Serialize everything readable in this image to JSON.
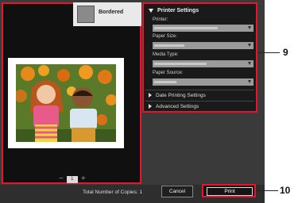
{
  "left": {
    "bordered_label": "Bordered",
    "page_number": "1",
    "prev": "−",
    "next": "+"
  },
  "printer_settings": {
    "header": "Printer Settings",
    "fields": [
      {
        "label": "Printer:"
      },
      {
        "label": "Paper Size:"
      },
      {
        "label": "Media Type:"
      },
      {
        "label": "Paper Source:"
      }
    ],
    "sections": [
      "Date Printing Settings",
      "Advanced Settings"
    ]
  },
  "footer": {
    "copies": "Total Number of Copies:  1",
    "cancel": "Cancel",
    "print": "Print"
  },
  "callouts": {
    "settings": "9",
    "print": "10"
  },
  "colors": {
    "highlight": "#e8132c",
    "panel": "#1a1a1a",
    "field": "#9a9a9a"
  }
}
